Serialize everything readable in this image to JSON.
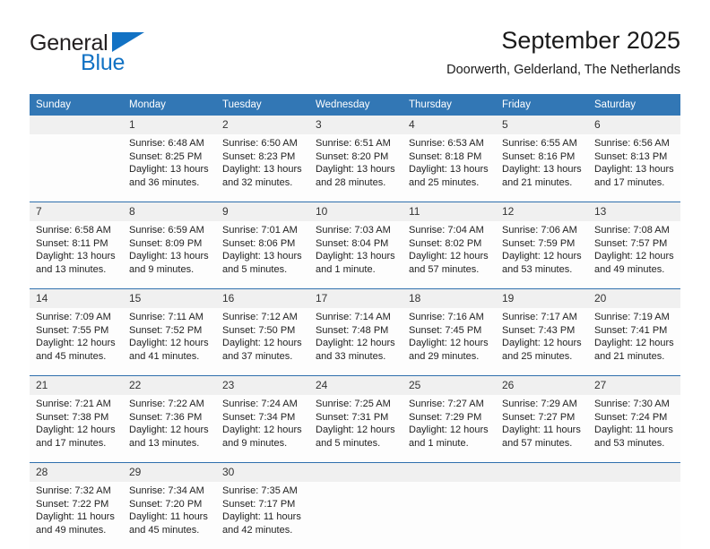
{
  "brand": {
    "name_part1": "General",
    "name_part2": "Blue",
    "accent_color": "#1272c4"
  },
  "header": {
    "title": "September 2025",
    "subtitle": "Doorwerth, Gelderland, The Netherlands"
  },
  "calendar": {
    "header_bg": "#3277b5",
    "daynum_bg": "#f0f0f0",
    "weekday_headers": [
      "Sunday",
      "Monday",
      "Tuesday",
      "Wednesday",
      "Thursday",
      "Friday",
      "Saturday"
    ],
    "weeks": [
      {
        "days": [
          {
            "num": "",
            "sunrise": "",
            "sunset": "",
            "daylight1": "",
            "daylight2": ""
          },
          {
            "num": "1",
            "sunrise": "Sunrise: 6:48 AM",
            "sunset": "Sunset: 8:25 PM",
            "daylight1": "Daylight: 13 hours",
            "daylight2": "and 36 minutes."
          },
          {
            "num": "2",
            "sunrise": "Sunrise: 6:50 AM",
            "sunset": "Sunset: 8:23 PM",
            "daylight1": "Daylight: 13 hours",
            "daylight2": "and 32 minutes."
          },
          {
            "num": "3",
            "sunrise": "Sunrise: 6:51 AM",
            "sunset": "Sunset: 8:20 PM",
            "daylight1": "Daylight: 13 hours",
            "daylight2": "and 28 minutes."
          },
          {
            "num": "4",
            "sunrise": "Sunrise: 6:53 AM",
            "sunset": "Sunset: 8:18 PM",
            "daylight1": "Daylight: 13 hours",
            "daylight2": "and 25 minutes."
          },
          {
            "num": "5",
            "sunrise": "Sunrise: 6:55 AM",
            "sunset": "Sunset: 8:16 PM",
            "daylight1": "Daylight: 13 hours",
            "daylight2": "and 21 minutes."
          },
          {
            "num": "6",
            "sunrise": "Sunrise: 6:56 AM",
            "sunset": "Sunset: 8:13 PM",
            "daylight1": "Daylight: 13 hours",
            "daylight2": "and 17 minutes."
          }
        ]
      },
      {
        "days": [
          {
            "num": "7",
            "sunrise": "Sunrise: 6:58 AM",
            "sunset": "Sunset: 8:11 PM",
            "daylight1": "Daylight: 13 hours",
            "daylight2": "and 13 minutes."
          },
          {
            "num": "8",
            "sunrise": "Sunrise: 6:59 AM",
            "sunset": "Sunset: 8:09 PM",
            "daylight1": "Daylight: 13 hours",
            "daylight2": "and 9 minutes."
          },
          {
            "num": "9",
            "sunrise": "Sunrise: 7:01 AM",
            "sunset": "Sunset: 8:06 PM",
            "daylight1": "Daylight: 13 hours",
            "daylight2": "and 5 minutes."
          },
          {
            "num": "10",
            "sunrise": "Sunrise: 7:03 AM",
            "sunset": "Sunset: 8:04 PM",
            "daylight1": "Daylight: 13 hours",
            "daylight2": "and 1 minute."
          },
          {
            "num": "11",
            "sunrise": "Sunrise: 7:04 AM",
            "sunset": "Sunset: 8:02 PM",
            "daylight1": "Daylight: 12 hours",
            "daylight2": "and 57 minutes."
          },
          {
            "num": "12",
            "sunrise": "Sunrise: 7:06 AM",
            "sunset": "Sunset: 7:59 PM",
            "daylight1": "Daylight: 12 hours",
            "daylight2": "and 53 minutes."
          },
          {
            "num": "13",
            "sunrise": "Sunrise: 7:08 AM",
            "sunset": "Sunset: 7:57 PM",
            "daylight1": "Daylight: 12 hours",
            "daylight2": "and 49 minutes."
          }
        ]
      },
      {
        "days": [
          {
            "num": "14",
            "sunrise": "Sunrise: 7:09 AM",
            "sunset": "Sunset: 7:55 PM",
            "daylight1": "Daylight: 12 hours",
            "daylight2": "and 45 minutes."
          },
          {
            "num": "15",
            "sunrise": "Sunrise: 7:11 AM",
            "sunset": "Sunset: 7:52 PM",
            "daylight1": "Daylight: 12 hours",
            "daylight2": "and 41 minutes."
          },
          {
            "num": "16",
            "sunrise": "Sunrise: 7:12 AM",
            "sunset": "Sunset: 7:50 PM",
            "daylight1": "Daylight: 12 hours",
            "daylight2": "and 37 minutes."
          },
          {
            "num": "17",
            "sunrise": "Sunrise: 7:14 AM",
            "sunset": "Sunset: 7:48 PM",
            "daylight1": "Daylight: 12 hours",
            "daylight2": "and 33 minutes."
          },
          {
            "num": "18",
            "sunrise": "Sunrise: 7:16 AM",
            "sunset": "Sunset: 7:45 PM",
            "daylight1": "Daylight: 12 hours",
            "daylight2": "and 29 minutes."
          },
          {
            "num": "19",
            "sunrise": "Sunrise: 7:17 AM",
            "sunset": "Sunset: 7:43 PM",
            "daylight1": "Daylight: 12 hours",
            "daylight2": "and 25 minutes."
          },
          {
            "num": "20",
            "sunrise": "Sunrise: 7:19 AM",
            "sunset": "Sunset: 7:41 PM",
            "daylight1": "Daylight: 12 hours",
            "daylight2": "and 21 minutes."
          }
        ]
      },
      {
        "days": [
          {
            "num": "21",
            "sunrise": "Sunrise: 7:21 AM",
            "sunset": "Sunset: 7:38 PM",
            "daylight1": "Daylight: 12 hours",
            "daylight2": "and 17 minutes."
          },
          {
            "num": "22",
            "sunrise": "Sunrise: 7:22 AM",
            "sunset": "Sunset: 7:36 PM",
            "daylight1": "Daylight: 12 hours",
            "daylight2": "and 13 minutes."
          },
          {
            "num": "23",
            "sunrise": "Sunrise: 7:24 AM",
            "sunset": "Sunset: 7:34 PM",
            "daylight1": "Daylight: 12 hours",
            "daylight2": "and 9 minutes."
          },
          {
            "num": "24",
            "sunrise": "Sunrise: 7:25 AM",
            "sunset": "Sunset: 7:31 PM",
            "daylight1": "Daylight: 12 hours",
            "daylight2": "and 5 minutes."
          },
          {
            "num": "25",
            "sunrise": "Sunrise: 7:27 AM",
            "sunset": "Sunset: 7:29 PM",
            "daylight1": "Daylight: 12 hours",
            "daylight2": "and 1 minute."
          },
          {
            "num": "26",
            "sunrise": "Sunrise: 7:29 AM",
            "sunset": "Sunset: 7:27 PM",
            "daylight1": "Daylight: 11 hours",
            "daylight2": "and 57 minutes."
          },
          {
            "num": "27",
            "sunrise": "Sunrise: 7:30 AM",
            "sunset": "Sunset: 7:24 PM",
            "daylight1": "Daylight: 11 hours",
            "daylight2": "and 53 minutes."
          }
        ]
      },
      {
        "days": [
          {
            "num": "28",
            "sunrise": "Sunrise: 7:32 AM",
            "sunset": "Sunset: 7:22 PM",
            "daylight1": "Daylight: 11 hours",
            "daylight2": "and 49 minutes."
          },
          {
            "num": "29",
            "sunrise": "Sunrise: 7:34 AM",
            "sunset": "Sunset: 7:20 PM",
            "daylight1": "Daylight: 11 hours",
            "daylight2": "and 45 minutes."
          },
          {
            "num": "30",
            "sunrise": "Sunrise: 7:35 AM",
            "sunset": "Sunset: 7:17 PM",
            "daylight1": "Daylight: 11 hours",
            "daylight2": "and 42 minutes."
          },
          {
            "num": "",
            "sunrise": "",
            "sunset": "",
            "daylight1": "",
            "daylight2": ""
          },
          {
            "num": "",
            "sunrise": "",
            "sunset": "",
            "daylight1": "",
            "daylight2": ""
          },
          {
            "num": "",
            "sunrise": "",
            "sunset": "",
            "daylight1": "",
            "daylight2": ""
          },
          {
            "num": "",
            "sunrise": "",
            "sunset": "",
            "daylight1": "",
            "daylight2": ""
          }
        ]
      }
    ]
  }
}
